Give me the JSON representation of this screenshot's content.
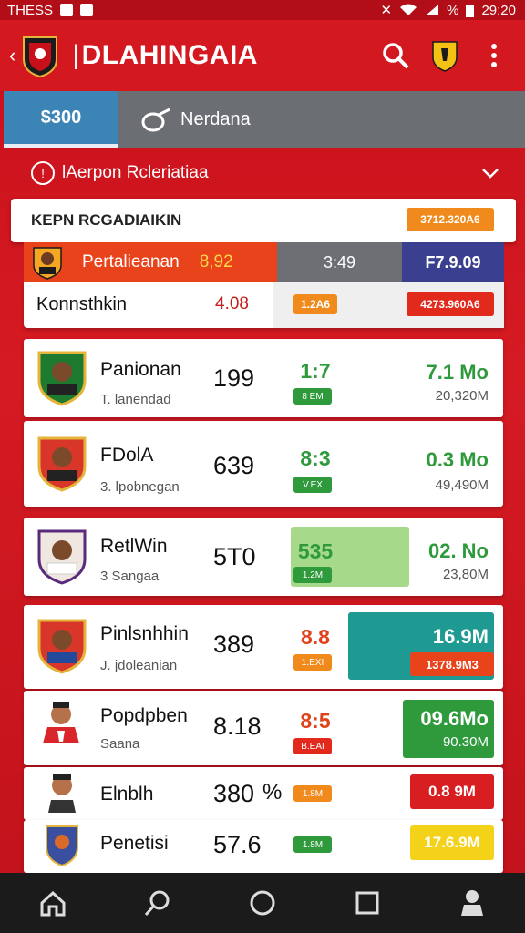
{
  "status": {
    "left_text": "THESS",
    "time": "29:20",
    "pct": "%"
  },
  "appbar": {
    "title": "DLAHINGAIA"
  },
  "tabs": [
    {
      "label": "$300"
    },
    {
      "label": "Nerdana"
    }
  ],
  "section": {
    "title": "lAerpon Rcleriatiaa"
  },
  "header": {
    "title": "KEPN RCGADIAIKIN",
    "pill": "3712.320A6"
  },
  "featured": {
    "name": "Pertalieanan",
    "value": "8,92",
    "mid": "3:49",
    "right": "F7.9.09",
    "sub_name": "Konnsthkin",
    "sub_value": "4.08",
    "sub_pill_left": "1.2A6",
    "sub_pill_right": "4273.960A6"
  },
  "players": [
    {
      "name": "Panionan",
      "sub": "T. lanendad",
      "num": "199",
      "mid": "1:7",
      "mid_pill": "8 EM",
      "right": "7.1 Mo",
      "right_sub": "20,320M"
    },
    {
      "name": "FDolA",
      "sub": "3. lpobnegan",
      "num": "639",
      "mid": "8:3",
      "mid_pill": "V.EX",
      "right": "0.3 Mo",
      "right_sub": "49,490M"
    },
    {
      "name": "RetlWin",
      "sub": "3 Sangaa",
      "num": "5T0",
      "mid": "535",
      "mid_pill": "1.2M",
      "right": "02. No",
      "right_sub": "23,80M"
    },
    {
      "name": "Pinlsnhhin",
      "sub": "J. jdoleanian",
      "num": "389",
      "mid": "8.8",
      "mid_pill": "1.EXI",
      "right": "16.9M",
      "right_sub": "1378.9M3"
    },
    {
      "name": "Popdpben",
      "sub": "Saana",
      "num": "8.18",
      "mid": "8:5",
      "mid_pill": "B.EAI",
      "right": "09.6Mo",
      "right_sub": "90.30M"
    },
    {
      "name": "Elnblh",
      "sub": "",
      "num": "380",
      "pct": "%",
      "mid": "",
      "mid_pill": "1.8M",
      "right": "0.8 9M",
      "right_sub": ""
    },
    {
      "name": "Penetisi",
      "sub": "",
      "num": "57.6",
      "mid": "",
      "mid_pill": "1.8M",
      "right": "17.6.9M",
      "right_sub": ""
    }
  ],
  "colors": {
    "brand_red": "#d41820",
    "tab_blue": "#3c84b5",
    "green": "#2e9a3c",
    "orange": "#f08a1c"
  }
}
